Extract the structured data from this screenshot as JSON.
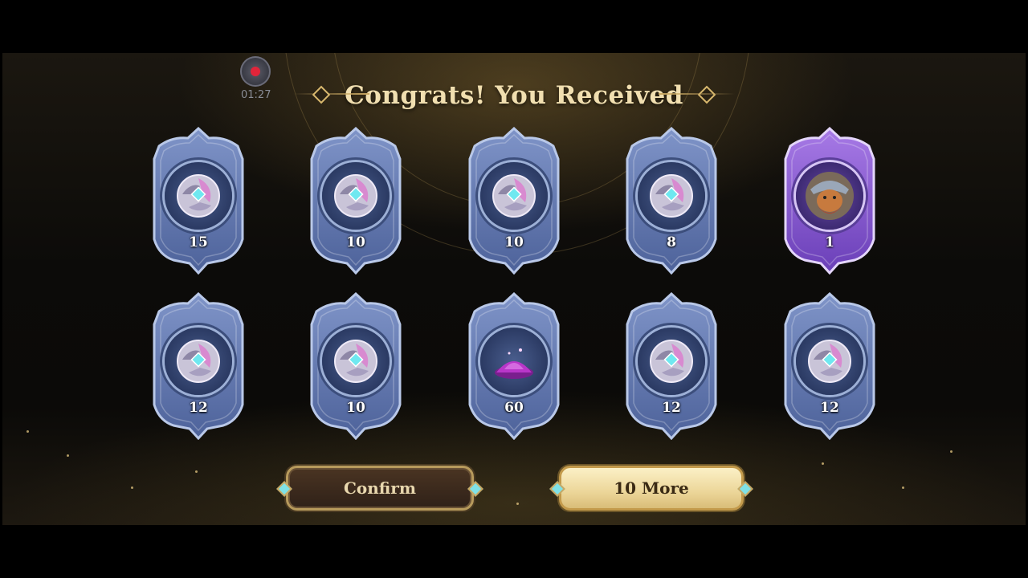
{
  "recorder": {
    "time": "01:27"
  },
  "header": {
    "title": "Congrats! You Received"
  },
  "rewards": [
    {
      "count": "15",
      "icon": "emblem-icon",
      "rarity": "blue"
    },
    {
      "count": "10",
      "icon": "emblem-icon",
      "rarity": "blue"
    },
    {
      "count": "10",
      "icon": "emblem-icon",
      "rarity": "blue"
    },
    {
      "count": "8",
      "icon": "emblem-icon",
      "rarity": "blue"
    },
    {
      "count": "1",
      "icon": "hero-portrait-icon",
      "rarity": "purple"
    },
    {
      "count": "12",
      "icon": "emblem-icon",
      "rarity": "blue"
    },
    {
      "count": "10",
      "icon": "emblem-icon",
      "rarity": "blue"
    },
    {
      "count": "60",
      "icon": "magic-dust-icon",
      "rarity": "blue"
    },
    {
      "count": "12",
      "icon": "emblem-icon",
      "rarity": "blue"
    },
    {
      "count": "12",
      "icon": "emblem-icon",
      "rarity": "blue"
    }
  ],
  "actions": {
    "confirm_label": "Confirm",
    "more_label": "10 More"
  },
  "colors": {
    "accent_gold": "#f1dfb0",
    "card_blue": "#6f86bd",
    "card_purple": "#9b6ad8"
  }
}
